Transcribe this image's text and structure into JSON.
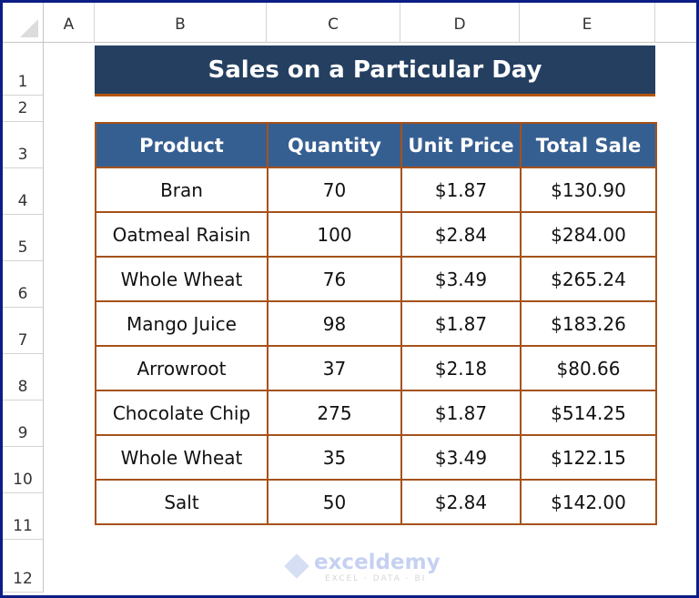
{
  "columns": [
    "A",
    "B",
    "C",
    "D",
    "E"
  ],
  "rows": [
    "1",
    "2",
    "3",
    "4",
    "5",
    "6",
    "7",
    "8",
    "9",
    "10",
    "11",
    "12"
  ],
  "title": "Sales on a Particular Day",
  "table": {
    "headers": [
      "Product",
      "Quantity",
      "Unit Price",
      "Total Sale"
    ],
    "rows": [
      [
        "Bran",
        "70",
        "$1.87",
        "$130.90"
      ],
      [
        "Oatmeal Raisin",
        "100",
        "$2.84",
        "$284.00"
      ],
      [
        "Whole Wheat",
        "76",
        "$3.49",
        "$265.24"
      ],
      [
        "Mango Juice",
        "98",
        "$1.87",
        "$183.26"
      ],
      [
        "Arrowroot",
        "37",
        "$2.18",
        "$80.66"
      ],
      [
        "Chocolate Chip",
        "275",
        "$1.87",
        "$514.25"
      ],
      [
        "Whole Wheat",
        "35",
        "$3.49",
        "$122.15"
      ],
      [
        "Salt",
        "50",
        "$2.84",
        "$142.00"
      ]
    ]
  },
  "watermark": {
    "name": "exceldemy",
    "tagline": "EXCEL · DATA · BI"
  },
  "colors": {
    "title_bg": "#243f60",
    "header_bg": "#365f91",
    "border": "#a5521b",
    "frame": "#0d1d85"
  }
}
